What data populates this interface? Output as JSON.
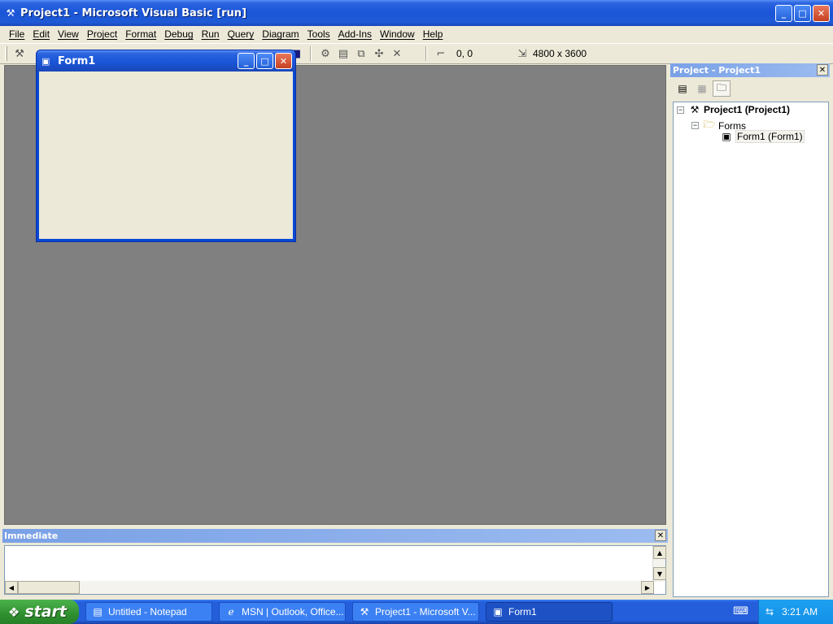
{
  "window": {
    "title": "Project1 - Microsoft Visual Basic [run]",
    "minimize_glyph": "_",
    "maximize_glyph": "□",
    "close_glyph": "✕"
  },
  "menu": [
    "File",
    "Edit",
    "View",
    "Project",
    "Format",
    "Debug",
    "Run",
    "Query",
    "Diagram",
    "Tools",
    "Add-Ins",
    "Window",
    "Help"
  ],
  "toolbar": {
    "position_readout": "0, 0",
    "size_readout": "4800 x 3600"
  },
  "form1": {
    "title": "Form1"
  },
  "project_explorer": {
    "title": "Project - Project1",
    "close_glyph": "✕",
    "tree": {
      "root": "Project1 (Project1)",
      "folder": "Forms",
      "item": "Form1 (Form1)"
    }
  },
  "immediate": {
    "title": "Immediate",
    "close_glyph": "✕"
  },
  "taskbar": {
    "start_label": "start",
    "tasks": [
      {
        "label": "Untitled - Notepad",
        "icon": "notepad-icon"
      },
      {
        "label": "MSN | Outlook, Office...",
        "icon": "ie-icon"
      },
      {
        "label": "Project1 - Microsoft V...",
        "icon": "vb-icon"
      },
      {
        "label": "Form1",
        "icon": "form-icon"
      }
    ],
    "clock": "3:21 AM"
  },
  "colors": {
    "titlebar_blue": "#245edb",
    "workspace_gray": "#808080",
    "start_green": "#2f8f2f"
  }
}
